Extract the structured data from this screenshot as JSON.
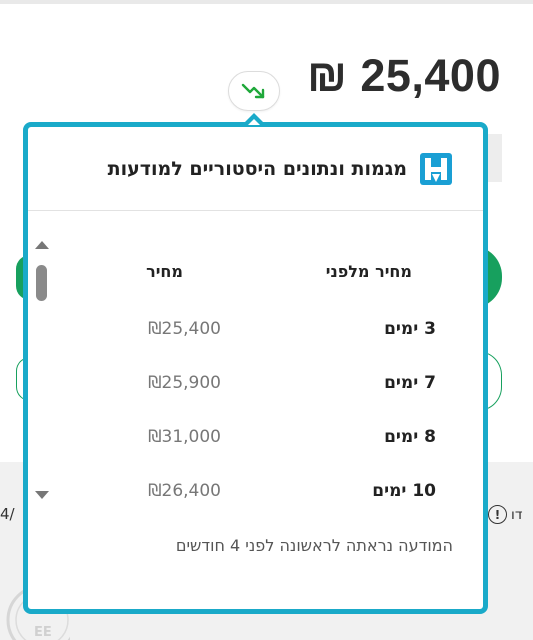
{
  "listing": {
    "price": "₪ 25,400",
    "trend_icon": "trending-down-icon"
  },
  "popup": {
    "title": "מגמות ונתונים היסטוריים למודעות",
    "logo_icon": "h-brand-logo",
    "columns": {
      "ago": "מחיר מלפני",
      "price": "מחיר"
    },
    "rows": [
      {
        "ago": "3 ימים",
        "price": "₪25,400"
      },
      {
        "ago": "7 ימים",
        "price": "₪25,900"
      },
      {
        "ago": "8 ימים",
        "price": "₪31,000"
      },
      {
        "ago": "10 ימים",
        "price": "₪26,400"
      }
    ],
    "first_seen": "המודעה נראתה לראשונה לפני 4 חודשים"
  },
  "background": {
    "right_fragment": "דו",
    "left_fragment": "4/",
    "info_glyph": "!"
  },
  "colors": {
    "popup_border": "#1aaac9",
    "green": "#17a05e",
    "trend": "#1fa83a"
  }
}
